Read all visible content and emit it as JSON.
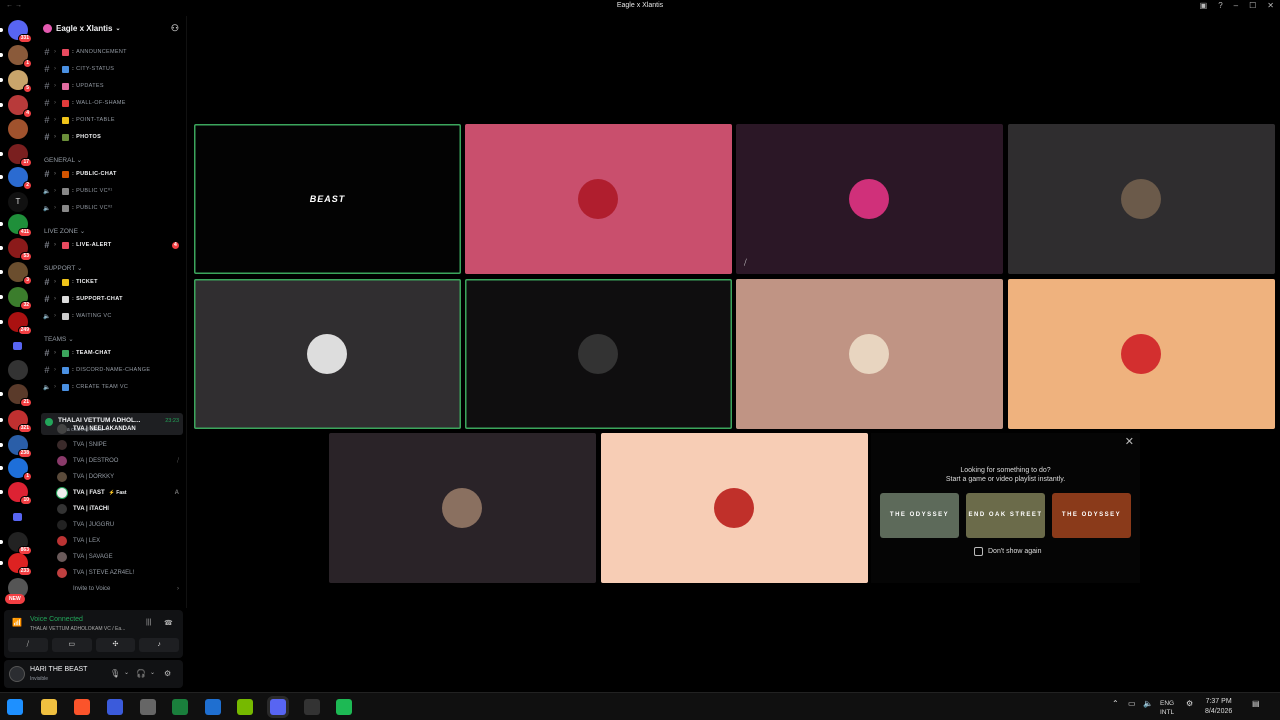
{
  "window": {
    "title": "Eagle x Xlantis",
    "nav": "← →"
  },
  "server": {
    "name": "Eagle x Xlantis"
  },
  "servers": [
    {
      "badge": "331",
      "color": "#5865f2"
    },
    {
      "badge": "1",
      "color": "#8a5a3a"
    },
    {
      "badge": "5",
      "color": "#c9a56b"
    },
    {
      "badge": "4",
      "color": "#b83a3a"
    },
    {
      "badge": "",
      "color": "#a0522d"
    },
    {
      "badge": "17",
      "color": "#7a1f1f"
    },
    {
      "badge": "2",
      "color": "#2b6bd1"
    },
    {
      "letter": "T"
    },
    {
      "badge": "411",
      "color": "#1f8f3a"
    },
    {
      "badge": "53",
      "color": "#8b1a1a"
    },
    {
      "badge": "3",
      "color": "#6b4e2e"
    },
    {
      "badge": "32",
      "color": "#3b7d2c"
    },
    {
      "badge": "249",
      "color": "#a11"
    },
    {
      "folder": true
    },
    {
      "badge": "",
      "color": "#333"
    },
    {
      "badge": "21",
      "color": "#5a3a2a"
    },
    {
      "badge": "321",
      "color": "#c03030"
    },
    {
      "badge": "238",
      "color": "#2a5ea8"
    },
    {
      "badge": "1",
      "color": "#1e6fd9"
    },
    {
      "badge": "10",
      "color": "#d23"
    },
    {
      "folder": true
    },
    {
      "badge": "863",
      "color": "#222"
    },
    {
      "badge": "233",
      "color": "#d22"
    },
    {
      "badge": "",
      "color": "#555"
    }
  ],
  "new_label": "NEW",
  "categories": {
    "general": "GENERAL ⌄",
    "live_zone": "LIVE ZONE ⌄",
    "support": "SUPPORT ⌄",
    "teams": "TEAMS ⌄"
  },
  "channels": [
    {
      "name": "ANNOUNCEMENT",
      "icon": "megaphone-icon",
      "color": "#e84a5f",
      "kind": "text"
    },
    {
      "name": "CITY-STATUS",
      "icon": "chart-icon",
      "color": "#4a90e2",
      "kind": "text"
    },
    {
      "name": "UPDATES",
      "icon": "page-icon",
      "color": "#e06c9f",
      "kind": "text"
    },
    {
      "name": "WALL-OF-SHAME",
      "icon": "pin-icon",
      "color": "#e23b3b",
      "kind": "text"
    },
    {
      "name": "POINT-TABLE",
      "icon": "trophy-icon",
      "color": "#f0c419",
      "kind": "text"
    },
    {
      "name": "PHOTOS",
      "icon": "photo-icon",
      "color": "#6b8f3a",
      "kind": "text",
      "bold": true
    },
    {
      "name": "PUBLIC-CHAT",
      "icon": "gear-icon",
      "color": "#d35400",
      "kind": "text",
      "bold": true
    },
    {
      "name": "PUBLIC VC⁰¹",
      "icon": "mic-icon",
      "color": "#888",
      "kind": "voice"
    },
    {
      "name": "PUBLIC VC⁰²",
      "icon": "mic-icon",
      "color": "#888",
      "kind": "voice"
    },
    {
      "name": "LIVE-ALERT",
      "icon": "megaphone-icon",
      "color": "#e84a5f",
      "kind": "text",
      "bold": true,
      "mention": "4"
    },
    {
      "name": "TICKET",
      "icon": "ticket-icon",
      "color": "#f0c419",
      "kind": "text",
      "bold": true
    },
    {
      "name": "SUPPORT-CHAT",
      "icon": "chat-icon",
      "color": "#ddd",
      "kind": "text",
      "bold": true
    },
    {
      "name": "WAITING VC",
      "icon": "hourglass-icon",
      "color": "#ccc",
      "kind": "voice"
    },
    {
      "name": "TEAM-CHAT",
      "icon": "alien-icon",
      "color": "#3ba55c",
      "kind": "text",
      "bold": true
    },
    {
      "name": "DISCORD-NAME-CHANGE",
      "icon": "diamond-icon",
      "color": "#4a90e2",
      "kind": "text"
    },
    {
      "name": "CREATE TEAM VC",
      "icon": "diamond-icon",
      "color": "#4a90e2",
      "kind": "voice"
    }
  ],
  "active_voice": {
    "name": "THALAI VETTUM ADHOL...",
    "time": "23:23",
    "status": "Set a channel status ✎"
  },
  "members": [
    {
      "name": "TVA | NEELAKANDAN",
      "color": "#444",
      "bright": true
    },
    {
      "name": "TVA | SNIPE",
      "color": "#3a2a2a"
    },
    {
      "name": "TVA | DESTROO",
      "color": "#8a3a6a",
      "side": "⧸"
    },
    {
      "name": "TVA | DORKKY",
      "color": "#5a4a3a"
    },
    {
      "name": "TVA | FAST",
      "color": "#eee",
      "bright": true,
      "speaking": true,
      "tag": "⚡ Fast",
      "side": "A"
    },
    {
      "name": "TVA | iTACHI",
      "color": "#333",
      "bright": true
    },
    {
      "name": "TVA | JUGGRU",
      "color": "#222"
    },
    {
      "name": "TVA | LEX",
      "color": "#b33"
    },
    {
      "name": "TVA | SAVAGE",
      "color": "#6a5a5a"
    },
    {
      "name": "TVA | STEVE AZR4EL!",
      "color": "#c04040"
    },
    {
      "name": "Invite to Voice",
      "color": "#000",
      "side": "›"
    }
  ],
  "voice_panel": {
    "title": "Voice Connected",
    "sub": "THALAI VETTUM ADHOLOKAM VC / Ea..."
  },
  "user": {
    "name": "HARI THE BEAST",
    "status": "Invisible"
  },
  "tiles": [
    {
      "bg": "#030303",
      "active": true,
      "label": "BEAST"
    },
    {
      "bg": "#c94f6d",
      "avatar": "#b01e2e"
    },
    {
      "bg": "#2b1726",
      "avatar": "#d0307a",
      "muted": true
    },
    {
      "bg": "#2f2d2f",
      "avatar": "#6b5a4a"
    },
    {
      "bg": "#302e30",
      "active": true,
      "avatar": "#ddd"
    },
    {
      "bg": "#0f0e0f",
      "active": true,
      "avatar": "#333"
    },
    {
      "bg": "#c09484",
      "avatar": "#e8d5c0"
    },
    {
      "bg": "#efb27e",
      "avatar": "#d32f2f"
    },
    {
      "bg": "#2a2328",
      "avatar": "#8a7060"
    },
    {
      "bg": "#f7cdb5",
      "avatar": "#c0302a"
    }
  ],
  "activity": {
    "line1": "Looking for something to do?",
    "line2": "Start a game or video playlist instantly.",
    "checkbox_label": "Don't show again",
    "games": [
      {
        "label": "THE ODYSSEY",
        "bg": "#5d6a5a"
      },
      {
        "label": "END OAK STREET",
        "bg": "#6b6b4a"
      },
      {
        "label": "THE ODYSSEY",
        "bg": "#8a3a1a"
      }
    ]
  },
  "taskbar": {
    "apps": [
      {
        "icon": "windows-icon",
        "color": "#1e90ff"
      },
      {
        "icon": "folder-icon",
        "color": "#f0c040"
      },
      {
        "icon": "brave-icon",
        "color": "#fb542b"
      },
      {
        "icon": "monitor-icon",
        "color": "#3b5bdb"
      },
      {
        "icon": "steam-icon",
        "color": "#666"
      },
      {
        "icon": "terminal-icon",
        "color": "#1a7f3c"
      },
      {
        "icon": "edge-icon",
        "color": "#1f6fd0"
      },
      {
        "icon": "nvidia-icon",
        "color": "#76b900"
      },
      {
        "icon": "discord-icon",
        "color": "#5865f2"
      },
      {
        "icon": "obs-icon",
        "color": "#333"
      },
      {
        "icon": "spotify-icon",
        "color": "#1db954"
      }
    ],
    "lang1": "ENG",
    "lang2": "INTL",
    "time": "7:37 PM",
    "date": "8/4/2026"
  }
}
